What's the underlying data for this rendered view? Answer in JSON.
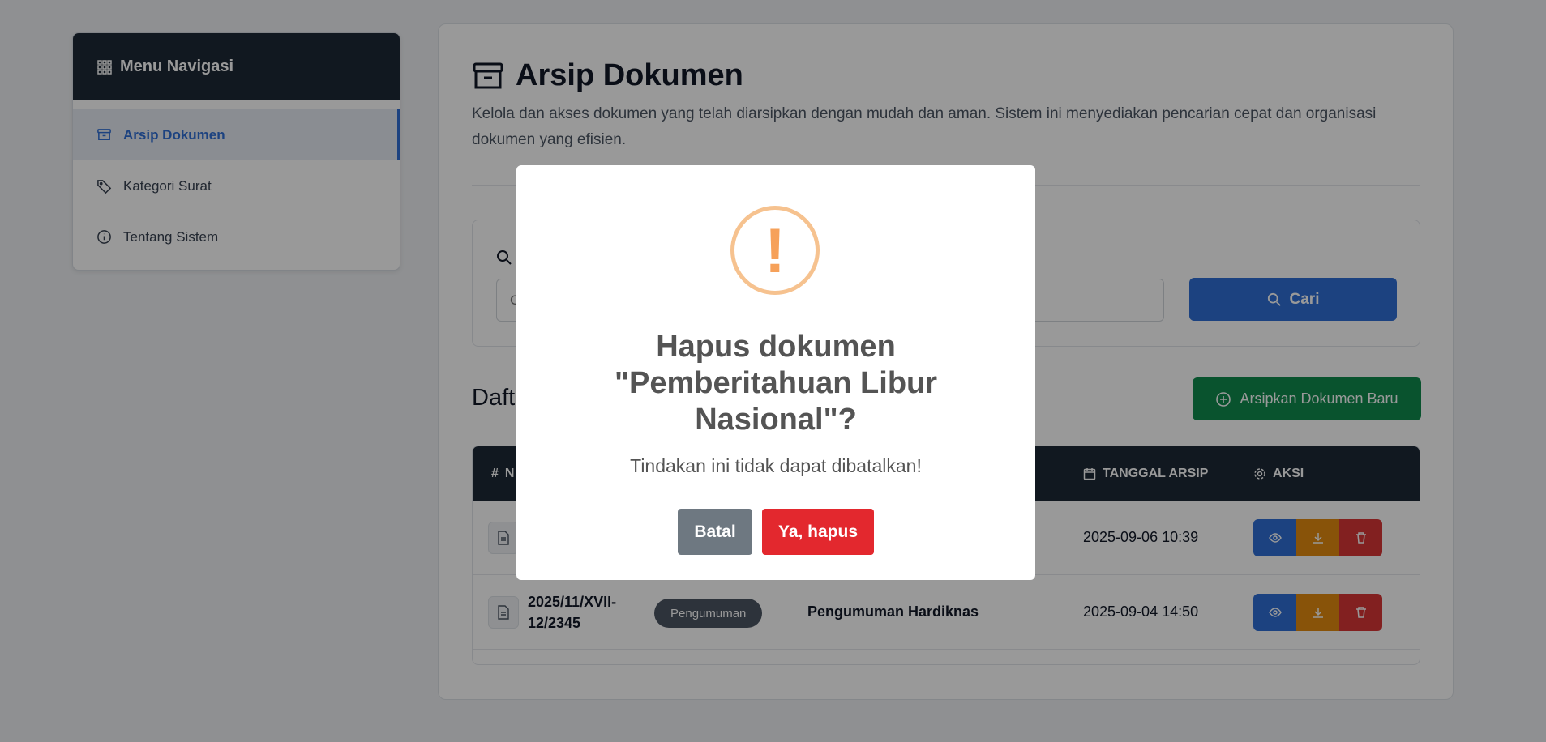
{
  "sidebar": {
    "title": "Menu Navigasi",
    "items": [
      {
        "label": "Arsip Dokumen"
      },
      {
        "label": "Kategori Surat"
      },
      {
        "label": "Tentang Sistem"
      }
    ]
  },
  "main": {
    "title": "Arsip Dokumen",
    "description": "Kelola dan akses dokumen yang telah diarsipkan dengan mudah dan aman. Sistem ini menyediakan pencarian cepat dan organisasi dokumen yang efisien.",
    "search_placeholder": "C",
    "search_button": "Cari",
    "list_title": "Daft",
    "add_button": "Arsipkan Dokumen Baru"
  },
  "table": {
    "headers": {
      "num": "N",
      "date": "TANGGAL ARSIP",
      "action": "AKSI"
    },
    "rows": [
      {
        "number": "",
        "category": "",
        "subject": "",
        "date": "2025-09-06 10:39"
      },
      {
        "number": "2025/11/XVII-12/2345",
        "category": "Pengumuman",
        "subject": "Pengumuman Hardiknas",
        "date": "2025-09-04 14:50"
      }
    ]
  },
  "modal": {
    "icon": "!",
    "title": "Hapus dokumen \"Pemberitahuan Libur Nasional\"?",
    "text": "Tindakan ini tidak dapat dibatalkan!",
    "cancel": "Batal",
    "confirm": "Ya, hapus"
  },
  "colors": {
    "primary": "#2f6fd6",
    "success": "#0f8a4d",
    "warning": "#e38a0f",
    "danger": "#d93636",
    "dark": "#1d2836"
  }
}
